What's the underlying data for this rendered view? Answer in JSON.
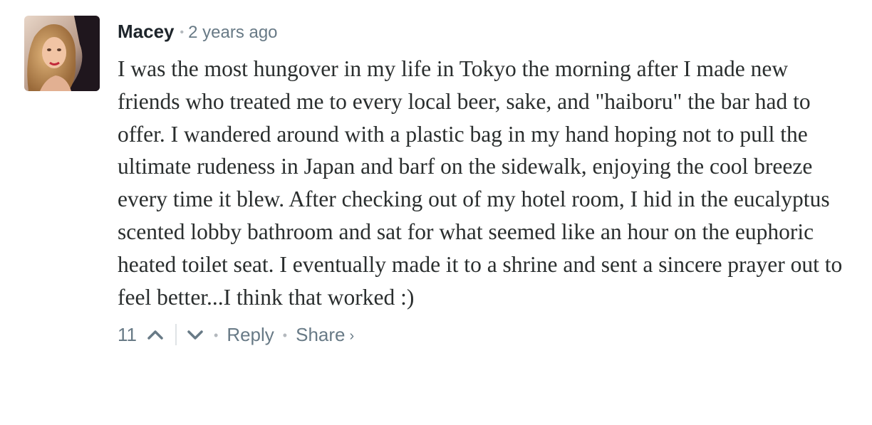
{
  "comment": {
    "author": "Macey",
    "separator": "•",
    "timestamp": "2 years ago",
    "body": "I was the most hungover in my life in Tokyo the morning after I made new friends who treated me to every local beer, sake, and \"haiboru\" the bar had to offer. I wandered around with a plastic bag in my hand hoping not to pull the ultimate rudeness in Japan and barf on the sidewalk, enjoying the cool breeze every time it blew. After checking out of my hotel room, I hid in the eucalyptus scented lobby bathroom and sat for what seemed like an hour on the euphoric heated toilet seat. I eventually made it to a shrine and sent a sincere prayer out to feel better...I think that worked :)",
    "votes": "11",
    "reply_label": "Reply",
    "share_label": "Share",
    "share_chevron": "›",
    "dot": "•"
  },
  "icons": {
    "upvote": "chevron-up-icon",
    "downvote": "chevron-down-icon"
  },
  "colors": {
    "author": "#1e252b",
    "meta": "#687a86",
    "body": "#2a2e2e",
    "divider": "#dfe3e6"
  }
}
